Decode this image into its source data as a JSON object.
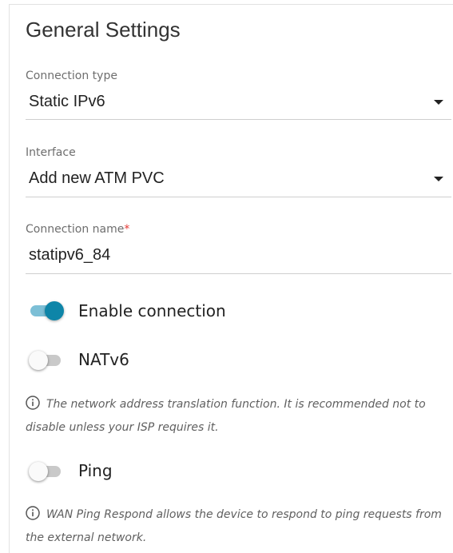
{
  "panel": {
    "title": "General Settings"
  },
  "connection_type": {
    "label": "Connection type",
    "value": "Static IPv6",
    "icon": "chevron-down-icon"
  },
  "interface": {
    "label": "Interface",
    "value": "Add new ATM PVC",
    "icon": "chevron-down-icon"
  },
  "connection_name": {
    "label": "Connection name",
    "required_mark": "*",
    "value": "statipv6_84"
  },
  "enable_connection": {
    "label": "Enable connection",
    "enabled": true
  },
  "natv6": {
    "label": "NATv6",
    "enabled": false,
    "hint": "The network address translation function. It is recommended not to disable unless your ISP requires it."
  },
  "ping": {
    "label": "Ping",
    "enabled": false,
    "hint": "WAN Ping Respond allows the device to respond to ping requests from the external network."
  },
  "colors": {
    "accent": "#0e85a8",
    "accent_track": "#7cbfd6",
    "required": "#e53935"
  }
}
